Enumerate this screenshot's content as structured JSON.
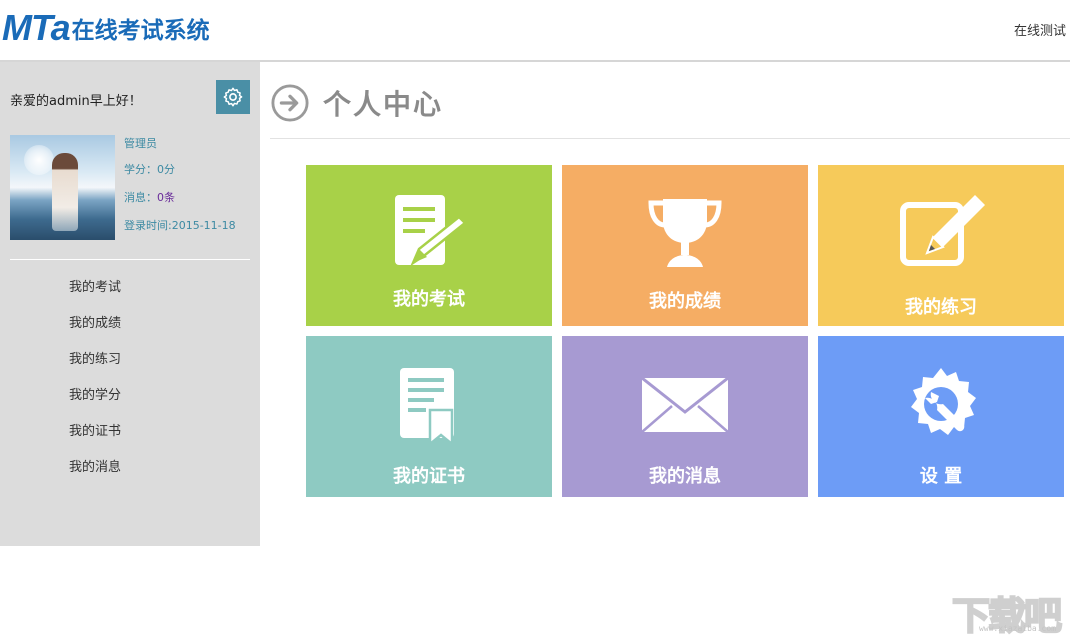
{
  "header": {
    "logo_mark": "MTa",
    "logo_text": "在线考试系统",
    "right_link": "在线测试",
    "brand_color": "#1a6bb8"
  },
  "sidebar": {
    "greeting": "亲爱的admin早上好！",
    "role": "管理员",
    "credits_label": "学分：",
    "credits_value": "0分",
    "messages_label": "消息：",
    "messages_value": "0条",
    "login_label": "登录时间:",
    "login_value": "2015-11-18",
    "menu": [
      {
        "label": "我的考试"
      },
      {
        "label": "我的成绩"
      },
      {
        "label": "我的练习"
      },
      {
        "label": "我的学分"
      },
      {
        "label": "我的证书"
      },
      {
        "label": "我的消息"
      }
    ]
  },
  "main": {
    "title": "个人中心",
    "tiles": [
      {
        "label": "我的考试",
        "icon": "exam-paper-pencil-icon",
        "color": "#a8d148"
      },
      {
        "label": "我的成绩",
        "icon": "trophy-icon",
        "color": "#f5ad64"
      },
      {
        "label": "我的练习",
        "icon": "edit-pencil-icon",
        "color": "#f6ca5a"
      },
      {
        "label": "我的证书",
        "icon": "certificate-icon",
        "color": "#8ecac2"
      },
      {
        "label": "我的消息",
        "icon": "envelope-icon",
        "color": "#a79ad2"
      },
      {
        "label": "设 置",
        "icon": "gear-wrench-icon",
        "color": "#6d9cf6"
      }
    ]
  },
  "watermark": {
    "text": "下载吧",
    "url": "www.xiazaiba.com"
  }
}
